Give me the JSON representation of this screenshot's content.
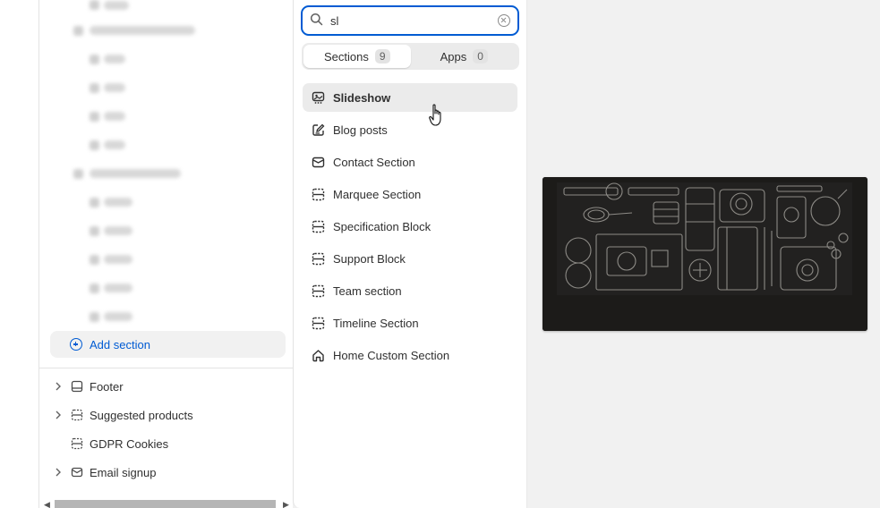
{
  "search": {
    "value": "sl",
    "clear_label": "Clear search"
  },
  "tabs": [
    {
      "label": "Sections",
      "count": "9",
      "active": true
    },
    {
      "label": "Apps",
      "count": "0",
      "active": false
    }
  ],
  "results": [
    {
      "label": "Slideshow",
      "icon": "slideshow-icon"
    },
    {
      "label": "Blog posts",
      "icon": "blog-icon"
    },
    {
      "label": "Contact Section",
      "icon": "envelope-icon"
    },
    {
      "label": "Marquee Section",
      "icon": "section-icon"
    },
    {
      "label": "Specification Block",
      "icon": "section-icon"
    },
    {
      "label": "Support Block",
      "icon": "section-icon"
    },
    {
      "label": "Team section",
      "icon": "section-icon"
    },
    {
      "label": "Timeline Section",
      "icon": "section-icon"
    },
    {
      "label": "Home Custom Section",
      "icon": "home-icon"
    }
  ],
  "tree": {
    "add_section": "Add section",
    "items": [
      {
        "label": "Footer",
        "icon": "footer-icon",
        "expandable": true
      },
      {
        "label": "Suggested products",
        "icon": "section-icon",
        "expandable": true
      },
      {
        "label": "GDPR Cookies",
        "icon": "section-icon",
        "expandable": false
      },
      {
        "label": "Email signup",
        "icon": "envelope-icon",
        "expandable": true
      }
    ]
  },
  "colors": {
    "accent": "#005bd3",
    "hover_bg": "#ebebeb",
    "preview_bg": "#1c1b19"
  }
}
